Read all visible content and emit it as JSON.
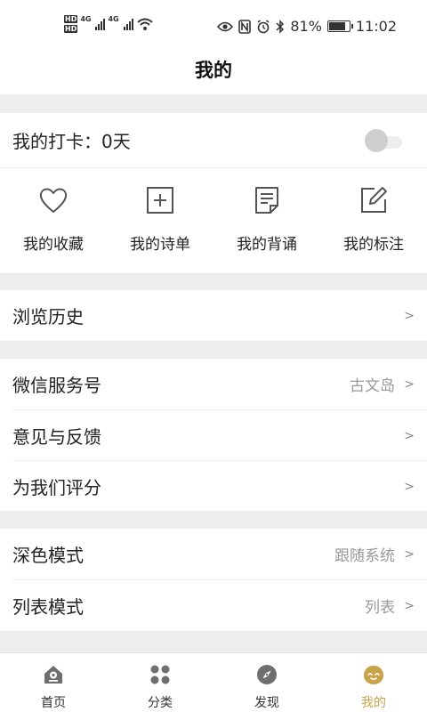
{
  "status": {
    "battery": "81%",
    "time": "11:02",
    "network": "4G",
    "hd": "HD"
  },
  "header": {
    "title": "我的"
  },
  "checkin": {
    "label": "我的打卡：0天"
  },
  "quick": [
    {
      "label": "我的收藏",
      "icon": "heart-icon"
    },
    {
      "label": "我的诗单",
      "icon": "plus-square-icon"
    },
    {
      "label": "我的背诵",
      "icon": "document-icon"
    },
    {
      "label": "我的标注",
      "icon": "edit-icon"
    }
  ],
  "history": {
    "label": "浏览历史"
  },
  "service": [
    {
      "label": "微信服务号",
      "value": "古文岛"
    },
    {
      "label": "意见与反馈",
      "value": ""
    },
    {
      "label": "为我们评分",
      "value": ""
    }
  ],
  "display": [
    {
      "label": "深色模式",
      "value": "跟随系统"
    },
    {
      "label": "列表模式",
      "value": "列表"
    }
  ],
  "chevron": ">",
  "tabs": [
    {
      "label": "首页",
      "icon": "home-icon"
    },
    {
      "label": "分类",
      "icon": "category-icon"
    },
    {
      "label": "发现",
      "icon": "compass-icon"
    },
    {
      "label": "我的",
      "icon": "profile-icon"
    }
  ],
  "colors": {
    "accent": "#c9a34a",
    "background": "#ededed",
    "card": "#ffffff"
  }
}
